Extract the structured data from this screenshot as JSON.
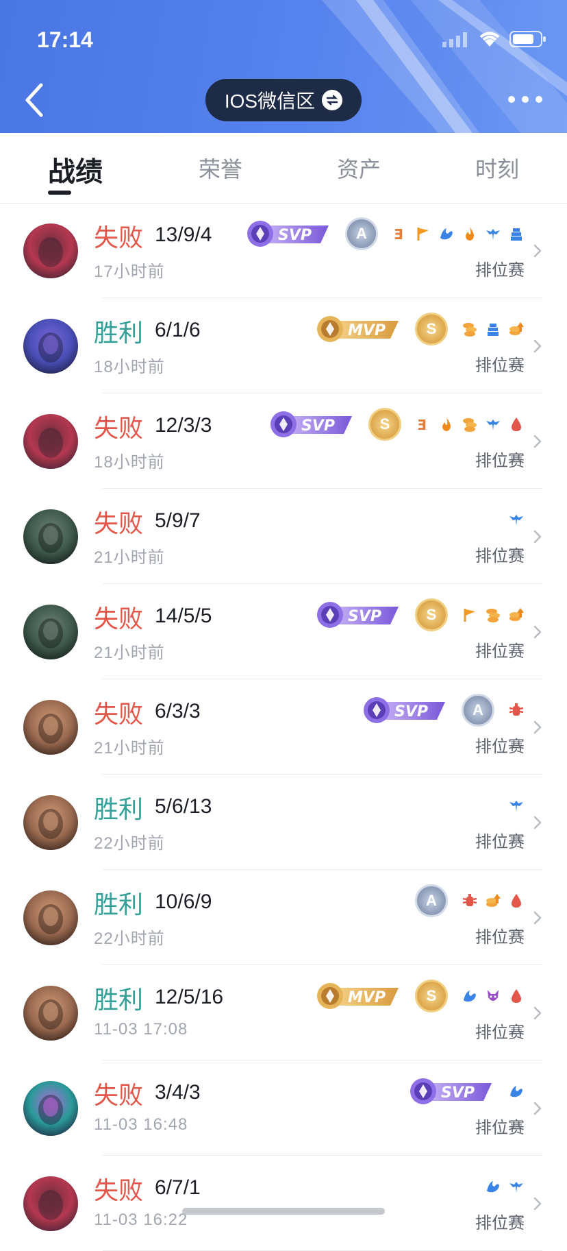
{
  "status_bar": {
    "time": "17:14"
  },
  "header": {
    "server_label": "IOS微信区"
  },
  "tabs": [
    {
      "label": "战绩",
      "active": true
    },
    {
      "label": "荣誉",
      "active": false
    },
    {
      "label": "资产",
      "active": false
    },
    {
      "label": "时刻",
      "active": false
    }
  ],
  "colors": {
    "lose": "#e3574a",
    "win": "#34a198",
    "header_blue": "#5783ee"
  },
  "matches": [
    {
      "result": "失败",
      "kda": "13/9/4",
      "time": "17小时前",
      "mode": "排位赛",
      "big_badge": "SVP",
      "medal": "A",
      "icons": [
        "triple-kill-icon",
        "flag-icon",
        "wing-icon",
        "fire-icon",
        "bird-icon",
        "tower-icon"
      ],
      "avatar": "hero-red-hair"
    },
    {
      "result": "胜利",
      "kda": "6/1/6",
      "time": "18小时前",
      "mode": "排位赛",
      "big_badge": "MVP",
      "medal": "S",
      "icons": [
        "coins-icon",
        "tower-icon",
        "coin-up-icon"
      ],
      "avatar": "hero-hooded"
    },
    {
      "result": "失败",
      "kda": "12/3/3",
      "time": "18小时前",
      "mode": "排位赛",
      "big_badge": "SVP",
      "medal": "S",
      "icons": [
        "triple-kill-icon",
        "fire-icon",
        "coins-icon",
        "bird-icon",
        "blood-drop-icon"
      ],
      "avatar": "hero-red-hair"
    },
    {
      "result": "失败",
      "kda": "5/9/7",
      "time": "21小时前",
      "mode": "排位赛",
      "big_badge": "",
      "medal": "",
      "icons": [
        "bird-icon"
      ],
      "avatar": "hero-armored"
    },
    {
      "result": "失败",
      "kda": "14/5/5",
      "time": "21小时前",
      "mode": "排位赛",
      "big_badge": "SVP",
      "medal": "S",
      "icons": [
        "flag-icon",
        "coins-icon",
        "coin-up-icon"
      ],
      "avatar": "hero-armored"
    },
    {
      "result": "失败",
      "kda": "6/3/3",
      "time": "21小时前",
      "mode": "排位赛",
      "big_badge": "SVP",
      "medal": "A",
      "icons": [
        "crab-icon"
      ],
      "avatar": "hero-warrior"
    },
    {
      "result": "胜利",
      "kda": "5/6/13",
      "time": "22小时前",
      "mode": "排位赛",
      "big_badge": "",
      "medal": "",
      "icons": [
        "bird-icon"
      ],
      "avatar": "hero-warrior"
    },
    {
      "result": "胜利",
      "kda": "10/6/9",
      "time": "22小时前",
      "mode": "排位赛",
      "big_badge": "",
      "medal": "A",
      "icons": [
        "crab-icon",
        "coin-up-icon",
        "blood-drop-icon"
      ],
      "avatar": "hero-warrior"
    },
    {
      "result": "胜利",
      "kda": "12/5/16",
      "time": "11-03 17:08",
      "mode": "排位赛",
      "big_badge": "MVP",
      "medal": "S",
      "icons": [
        "wing-icon",
        "demon-icon",
        "blood-drop-icon"
      ],
      "avatar": "hero-warrior"
    },
    {
      "result": "失败",
      "kda": "3/4/3",
      "time": "11-03 16:48",
      "mode": "排位赛",
      "big_badge": "SVP",
      "medal": "",
      "icons": [
        "wing-icon"
      ],
      "avatar": "hero-teal"
    },
    {
      "result": "失败",
      "kda": "6/7/1",
      "time": "11-03 16:22",
      "mode": "排位赛",
      "big_badge": "",
      "medal": "",
      "icons": [
        "wing-icon",
        "bird-icon"
      ],
      "avatar": "hero-red-hair"
    }
  ]
}
